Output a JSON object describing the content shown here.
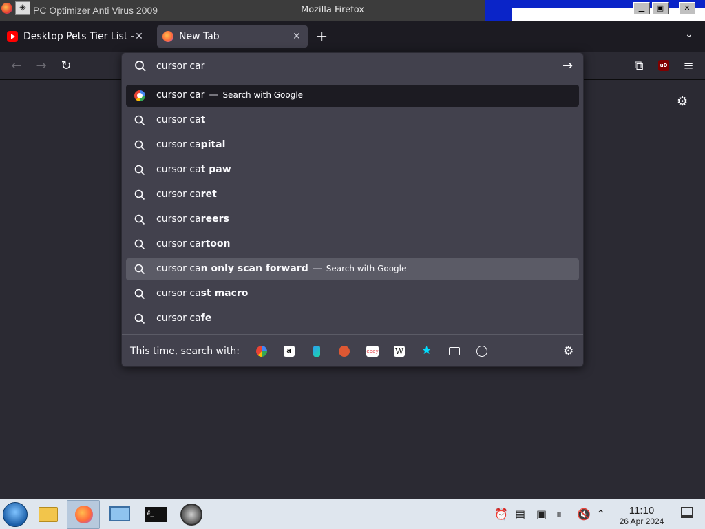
{
  "window": {
    "title": "Mozilla Firefox",
    "overlay_title": "PC Optimizer Anti Virus 2009",
    "min_glyph": "▁",
    "max_glyph": "▣",
    "close_glyph": "✕",
    "sys_glyph": "◈"
  },
  "tabs": [
    {
      "label": "Desktop Pets Tier List - Y",
      "active": false,
      "icon": "youtube-icon"
    },
    {
      "label": "New Tab",
      "active": true,
      "icon": "firefox-icon"
    }
  ],
  "tab_close_glyph": "✕",
  "new_tab_glyph": "+",
  "tabs_menu_glyph": "⌄",
  "nav": {
    "back_glyph": "←",
    "forward_glyph": "→",
    "reload_glyph": "↻",
    "extensions_glyph": "⧉",
    "ublock_text": "uD",
    "menu_glyph": "≡",
    "gear_glyph": "⚙"
  },
  "urlbar": {
    "value": "cursor car",
    "go_glyph": "→",
    "suggestions": [
      {
        "typed": "cursor car",
        "bold": "",
        "suffix": "Search with Google",
        "icon": "google-icon",
        "state": "selected"
      },
      {
        "typed": "cursor ca",
        "bold": "t",
        "suffix": "",
        "icon": "search-icon",
        "state": ""
      },
      {
        "typed": "cursor ca",
        "bold": "pital",
        "suffix": "",
        "icon": "search-icon",
        "state": ""
      },
      {
        "typed": "cursor ca",
        "bold": "t paw",
        "suffix": "",
        "icon": "search-icon",
        "state": ""
      },
      {
        "typed": "cursor ca",
        "bold": "ret",
        "suffix": "",
        "icon": "search-icon",
        "state": ""
      },
      {
        "typed": "cursor ca",
        "bold": "reers",
        "suffix": "",
        "icon": "search-icon",
        "state": ""
      },
      {
        "typed": "cursor ca",
        "bold": "rtoon",
        "suffix": "",
        "icon": "search-icon",
        "state": ""
      },
      {
        "typed": "cursor ca",
        "bold": "n only scan forward",
        "suffix": "Search with Google",
        "icon": "search-icon",
        "state": "hover"
      },
      {
        "typed": "cursor ca",
        "bold": "st macro",
        "suffix": "",
        "icon": "search-icon",
        "state": ""
      },
      {
        "typed": "cursor ca",
        "bold": "fe",
        "suffix": "",
        "icon": "search-icon",
        "state": ""
      }
    ],
    "dash": "—",
    "footer_label": "This time, search with:",
    "engines": [
      {
        "name": "google-engine-icon",
        "color": "#4285f4"
      },
      {
        "name": "amazon-engine-icon",
        "color": "#ffffff"
      },
      {
        "name": "bing-engine-icon",
        "color": "#2b9ff2"
      },
      {
        "name": "duckduckgo-engine-icon",
        "color": "#de5833"
      },
      {
        "name": "ebay-engine-icon",
        "color": "#ffffff"
      },
      {
        "name": "wikipedia-engine-icon",
        "color": "#ffffff"
      },
      {
        "name": "bookmarks-icon",
        "color": "#00ddff"
      },
      {
        "name": "tabs-icon",
        "color": "#fbfbfe"
      },
      {
        "name": "history-icon",
        "color": "#fbfbfe"
      }
    ],
    "ebay_text": "ebay",
    "wiki_text": "W",
    "amazon_text": "a"
  },
  "taskbar": {
    "terminal_text": "#_",
    "time": "11:10",
    "date": "26 Apr 2024"
  }
}
